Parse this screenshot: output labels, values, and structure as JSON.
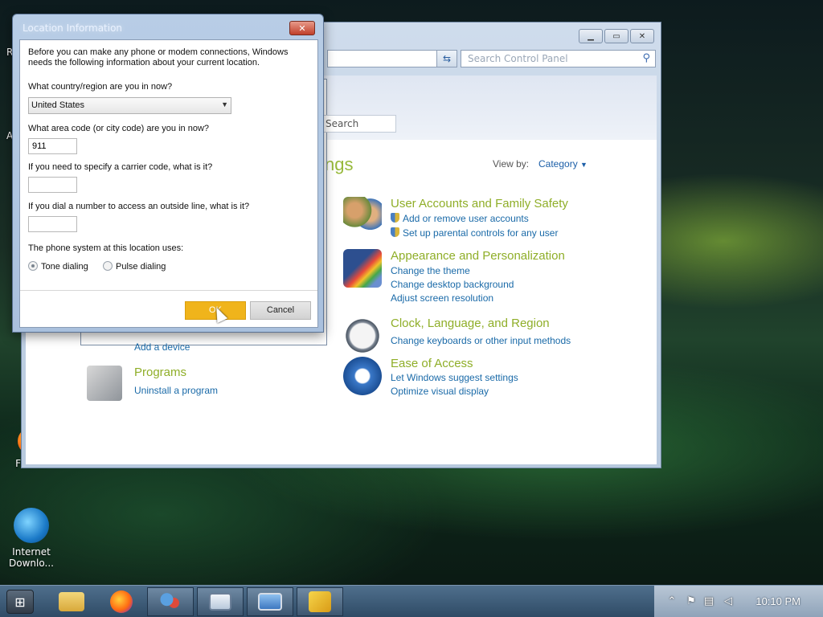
{
  "desktop": {
    "edge_letters": [
      "R",
      "A"
    ],
    "icons": [
      {
        "label": "Firefox"
      },
      {
        "label": "Internet Downlo..."
      }
    ]
  },
  "control_panel": {
    "search_placeholder": "Search Control Panel",
    "heading_fragment": "ngs",
    "view_by_label": "View by:",
    "view_by_value": "Category",
    "categories": [
      {
        "title": "User Accounts and Family Safety",
        "icon": "users-icon",
        "links": [
          "Add or remove user accounts",
          "Set up parental controls for any user"
        ]
      },
      {
        "title": "Appearance and Personalization",
        "icon": "monitor-paint-icon",
        "links": [
          "Change the theme",
          "Change desktop background",
          "Adjust screen resolution"
        ]
      },
      {
        "title": "Clock, Language, and Region",
        "icon": "clock-globe-icon",
        "links": [
          "Change keyboards or other input methods"
        ]
      },
      {
        "title": "Ease of Access",
        "icon": "ease-of-access-icon",
        "links": [
          "Let Windows suggest settings",
          "Optimize visual display"
        ]
      },
      {
        "title": "Programs",
        "icon": "programs-icon",
        "links": [
          "Uninstall a program"
        ]
      }
    ],
    "partial_link": "Add a device",
    "inner_search": "Search"
  },
  "location_dialog": {
    "title": "Location Information",
    "intro": "Before you can make any phone or modem connections, Windows needs the following information about your current location.",
    "country_label": "What country/region are you in now?",
    "country_value": "United States",
    "area_code_label": "What area code (or city code) are you in now?",
    "area_code_value": "911",
    "carrier_label": "If you need to specify a carrier code, what is it?",
    "carrier_value": "",
    "outside_line_label": "If you dial a number to access an outside line, what is it?",
    "outside_line_value": "",
    "phone_system_label": "The phone system at this location uses:",
    "tone_label": "Tone dialing",
    "pulse_label": "Pulse dialing",
    "ok_label": "OK",
    "cancel_label": "Cancel"
  },
  "taskbar": {
    "clock": "10:10 PM"
  },
  "colors": {
    "link": "#1a6aa8",
    "category_title": "#8fae28",
    "ok_button": "#f0b41b"
  }
}
